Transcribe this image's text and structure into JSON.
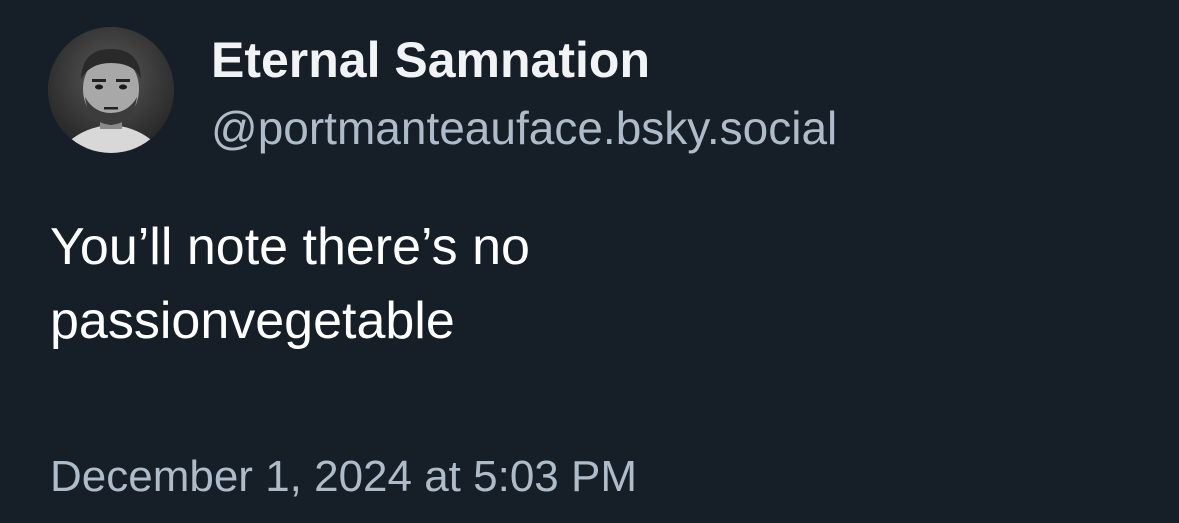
{
  "post": {
    "author": {
      "display_name": "Eternal Samnation",
      "handle": "@portmanteauface.bsky.social",
      "avatar_icon": "avatar-photo"
    },
    "text_lines": [
      "You’ll note there’s no",
      "passionvegetable"
    ],
    "timestamp": "December 1, 2024 at 5:03 PM"
  },
  "colors": {
    "background": "#161e27",
    "display_name": "#f1f3f5",
    "secondary_text": "#aebbc9",
    "body_text": "#ffffff"
  }
}
